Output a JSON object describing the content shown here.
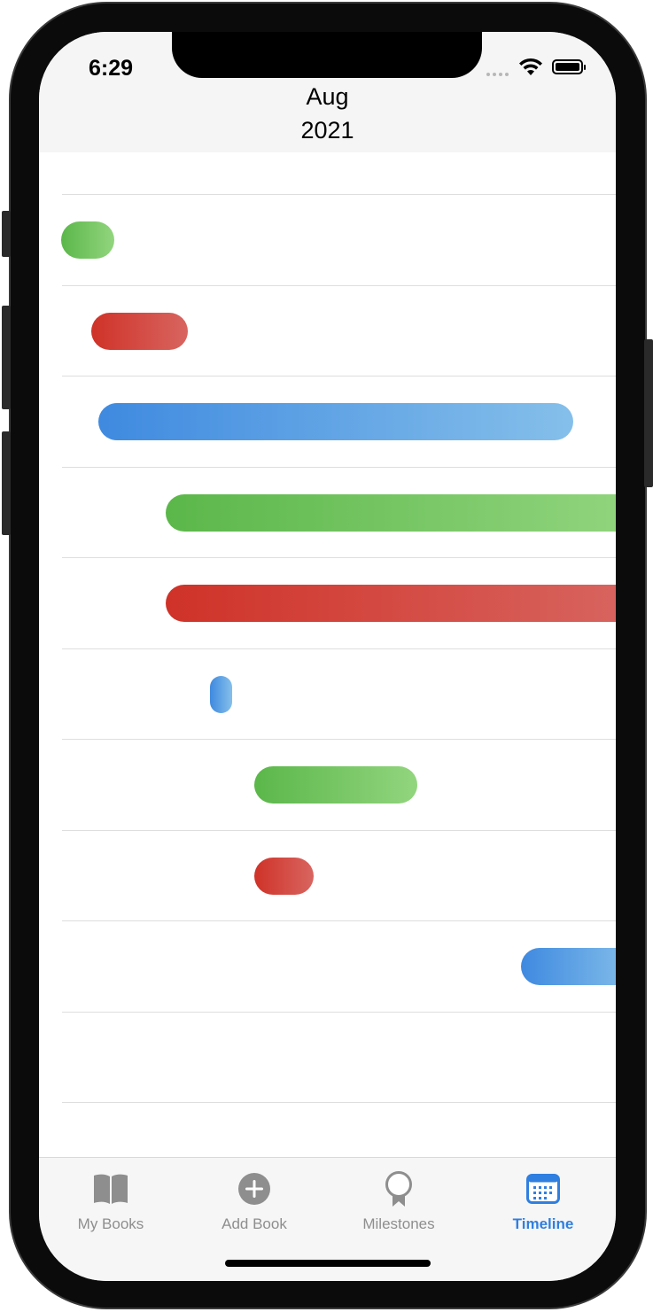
{
  "status_bar": {
    "time": "6:29"
  },
  "header": {
    "month": "Aug",
    "year": "2021"
  },
  "timeline": {
    "rows": [
      {
        "color": "green"
      },
      {
        "color": "red"
      },
      {
        "color": "blue"
      },
      {
        "color": "green"
      },
      {
        "color": "red"
      },
      {
        "color": "blue"
      },
      {
        "color": "green"
      },
      {
        "color": "red"
      },
      {
        "color": "blue"
      },
      {
        "color": "none"
      },
      {
        "color": "none"
      }
    ]
  },
  "tabbar": {
    "tabs": [
      {
        "label": "My Books",
        "icon": "book-icon",
        "active": false
      },
      {
        "label": "Add Book",
        "icon": "plus-circle-icon",
        "active": false
      },
      {
        "label": "Milestones",
        "icon": "award-icon",
        "active": false
      },
      {
        "label": "Timeline",
        "icon": "calendar-icon",
        "active": true
      }
    ]
  },
  "colors": {
    "green": "#5bb74a",
    "red": "#cf3228",
    "blue": "#3f8ae0",
    "active_tab": "#2f7fe0",
    "inactive_tab": "#8e8e8e"
  }
}
